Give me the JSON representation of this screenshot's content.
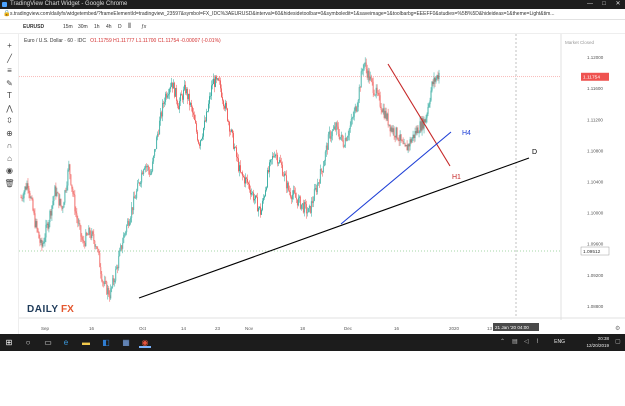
{
  "window": {
    "title": "TradingView Chart Widget - Google Chrome",
    "min_label": "—",
    "max_label": "□",
    "close_label": "✕"
  },
  "address": {
    "url": "s.tradingview.com/dailyfx/widgetembed/?frameElementId=tradingview_23597&symbol=FX_IDC%3AEURUSD&interval=60&hidesidetoolbar=0&symboledit=1&saveimage=1&toolbarbg=EEEFF0&studies=%5B%5D&hideideas=1&theme=Light&tim..."
  },
  "toolbar": {
    "symbol": "EURUSD",
    "intervals": [
      "15m",
      "30m",
      "1h",
      "4h",
      "D"
    ],
    "chart_type_icon": "candles-icon",
    "indicators_icon": "fx-icon"
  },
  "legend": {
    "name": "Euro / U.S. Dollar · 60 · IDC",
    "ohlc": "O1.11759  H1.11777  L1.11700  C1.11754  -0.00007 (-0.01%)"
  },
  "market_status": "Market Closed",
  "left_tools": [
    "crosshair-icon",
    "trendline-icon",
    "fib-icon",
    "brush-icon",
    "text-icon",
    "pattern-icon",
    "measure-icon",
    "zoom-icon",
    "magnet-icon",
    "lock-icon",
    "eye-icon",
    "trash-icon"
  ],
  "left_tool_glyphs": [
    "+",
    "╱",
    "≡",
    "✎",
    "T",
    "⋀",
    "⇳",
    "⊕",
    "∩",
    "⌂",
    "◉",
    "🗑"
  ],
  "logo": {
    "part1": "DAILY",
    "part2": "FX"
  },
  "colors": {
    "up": "#26a69a",
    "down": "#ef5350",
    "h1_line": "#c62828",
    "h4_line": "#1e3fd6",
    "d_line": "#000000",
    "price_tag": "#ef5350",
    "level_line": "#4caf50"
  },
  "chart_data": {
    "type": "candlestick",
    "x_ticks": [
      "Sep",
      "16",
      "Oct",
      "14",
      "23",
      "Nov",
      "18",
      "Dec",
      "16",
      "2020",
      "13"
    ],
    "y_ticks": [
      "1.12000",
      "1.11600",
      "1.11200",
      "1.10800",
      "1.10400",
      "1.10000",
      "1.09600",
      "1.09200",
      "1.08800"
    ],
    "ylim": [
      1.0865,
      1.1215
    ],
    "current_price": "1.11754",
    "level_price": "1.09512",
    "crosshair_date": "21 Jan '20   04:00",
    "trendlines": [
      {
        "label": "H1",
        "from": [
          "Dec 13",
          1.12
        ],
        "to": [
          "Jan 6",
          1.1063
        ]
      },
      {
        "label": "H4",
        "from": [
          "Nov 29",
          1.099
        ],
        "to": [
          "Jan 7",
          1.1115
        ]
      },
      {
        "label": "D",
        "from": [
          "Oct 1",
          1.0885
        ],
        "to": [
          "Jan 19",
          1.1072
        ]
      }
    ],
    "price_path": [
      1.102,
      1.104,
      1.099,
      1.0955,
      1.099,
      1.103,
      1.1005,
      1.106,
      1.1,
      1.096,
      1.0975,
      1.096,
      1.091,
      1.0895,
      1.093,
      1.097,
      1.1,
      1.103,
      1.1065,
      1.105,
      1.1105,
      1.115,
      1.117,
      1.114,
      1.116,
      1.113,
      1.109,
      1.112,
      1.117,
      1.1165,
      1.113,
      1.109,
      1.105,
      1.104,
      1.102,
      1.1,
      1.105,
      1.108,
      1.106,
      1.103,
      1.102,
      1.101,
      1.1,
      1.103,
      1.106,
      1.11,
      1.111,
      1.109,
      1.111,
      1.114,
      1.1195,
      1.117,
      1.115,
      1.113,
      1.111,
      1.11,
      1.108,
      1.1095,
      1.111,
      1.112,
      1.1165,
      1.118
    ]
  }
}
